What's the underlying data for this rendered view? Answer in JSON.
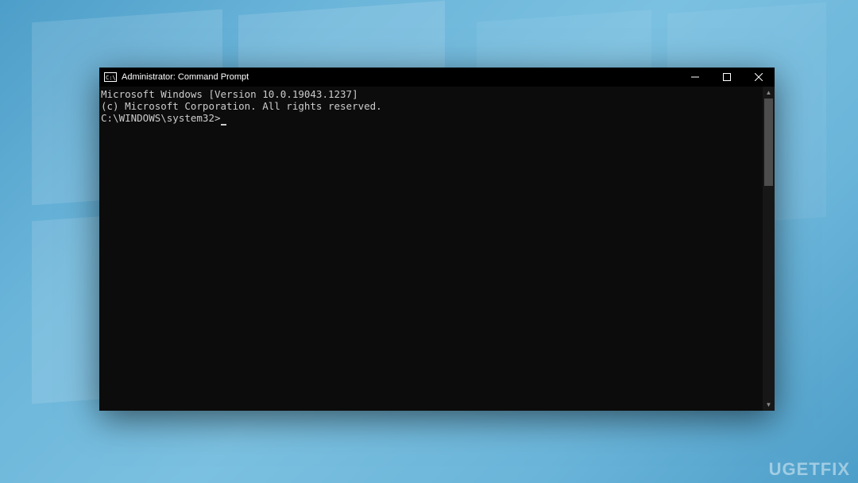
{
  "window": {
    "title": "Administrator: Command Prompt",
    "controls": {
      "minimize_label": "Minimize",
      "maximize_label": "Maximize",
      "close_label": "Close"
    }
  },
  "terminal": {
    "lines": [
      "Microsoft Windows [Version 10.0.19043.1237]",
      "(c) Microsoft Corporation. All rights reserved.",
      ""
    ],
    "prompt": "C:\\WINDOWS\\system32>",
    "current_input": ""
  },
  "watermark": "UGETFIX"
}
